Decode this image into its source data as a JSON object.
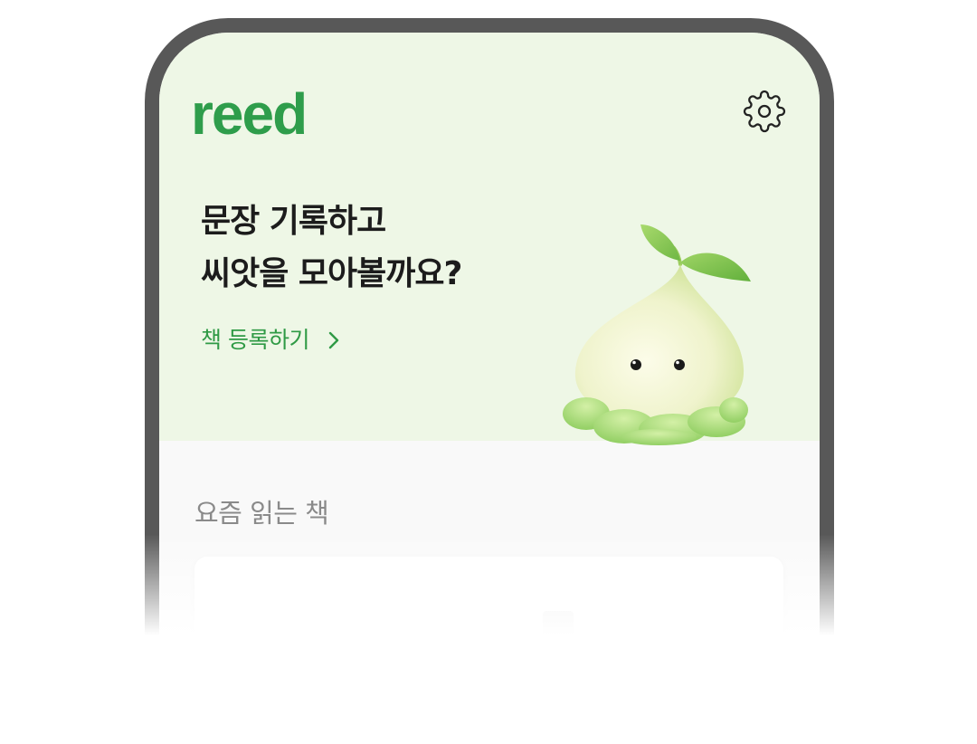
{
  "app": {
    "logo_text": "reed"
  },
  "header": {
    "settings_icon": "gear-icon"
  },
  "hero": {
    "headline_line1": "문장 기록하고",
    "headline_line2": "씨앗을 모아볼까요?",
    "cta_label": "책 등록하기",
    "cta_icon": "chevron-right-icon",
    "mascot": "seed-sprout-mascot"
  },
  "reading": {
    "section_title": "요즘 읽는 책"
  },
  "colors": {
    "brand_green": "#2e9d4b",
    "cta_green": "#2f9a45",
    "hero_background": "#eef7e6",
    "content_background": "#f9f9f9",
    "device_bezel": "#585858"
  }
}
